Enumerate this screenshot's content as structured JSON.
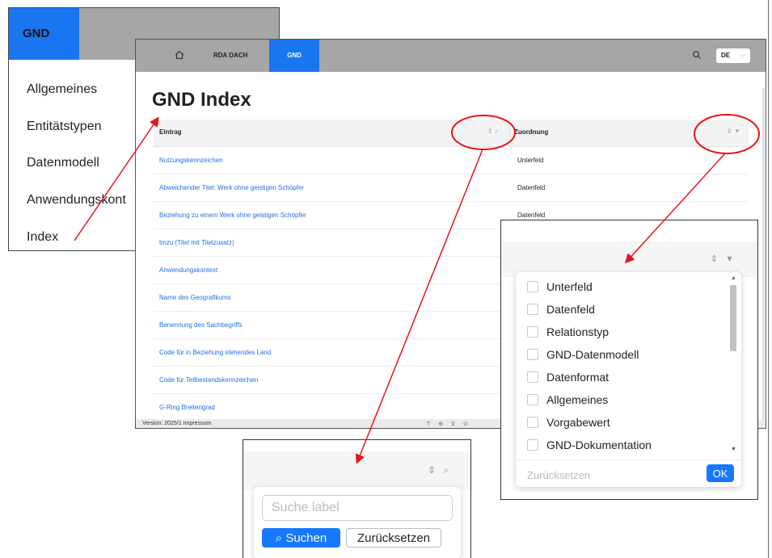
{
  "nav_menu": {
    "brand": "GND",
    "items": [
      "Allgemeines",
      "Entitätstypen",
      "Datenmodell",
      "Anwendungskont",
      "Index"
    ]
  },
  "main": {
    "topbar": {
      "home_icon": "home-icon",
      "nav_items": [
        "RDA DACH",
        "GND"
      ],
      "search_icon": "search-icon",
      "language": "DE",
      "language_chevron": "⌵"
    },
    "title": "GND Index",
    "table": {
      "columns": [
        "Eintrag",
        "Zuordnung"
      ],
      "sort_icons": [
        "⇕ ⌕",
        "⇕ ▼"
      ],
      "rows": [
        {
          "entry": "Nutzungskennzeichen",
          "assignment": "Unterfeld"
        },
        {
          "entry": "Abweichender Titel: Werk ohne geistigen Schöpfer",
          "assignment": "Datenfeld"
        },
        {
          "entry": "Beziehung zu einem Werk ohne geistigen Schöpfer",
          "assignment": "Datenfeld"
        },
        {
          "entry": "tmzu (Titel mit Titelzusatz)",
          "assignment": ""
        },
        {
          "entry": "Anwendungskontext",
          "assignment": ""
        },
        {
          "entry": "Name des Geografikums",
          "assignment": ""
        },
        {
          "entry": "Benennung des Sachbegriffs",
          "assignment": ""
        },
        {
          "entry": "Code für in Beziehung stehendes Land",
          "assignment": ""
        },
        {
          "entry": "Code für Teilbestandskennzeichen",
          "assignment": ""
        },
        {
          "entry": "G-Ring Breitengrad",
          "assignment": ""
        }
      ]
    },
    "footer": {
      "text": "Version: 2025/1   Impressum",
      "icons": "T ⊕ ⊻ ⊙"
    }
  },
  "filter_popup": {
    "header_icons": "⇕ ▼",
    "options": [
      "Unterfeld",
      "Datenfeld",
      "Relationstyp",
      "GND-Datenmodell",
      "Datenformat",
      "Allgemeines",
      "Vorgabewert",
      "GND-Dokumentation"
    ],
    "reset_label": "Zurücksetzen",
    "ok_label": "OK",
    "scroll_up": "▲",
    "scroll_down": "▼"
  },
  "search_popup": {
    "header_icons": "⇕ ⌕",
    "placeholder": "Suche label",
    "search_label": "⌕ Suchen",
    "reset_label": "Zurücksetzen"
  },
  "annotation": {
    "color": "#e8141a"
  }
}
